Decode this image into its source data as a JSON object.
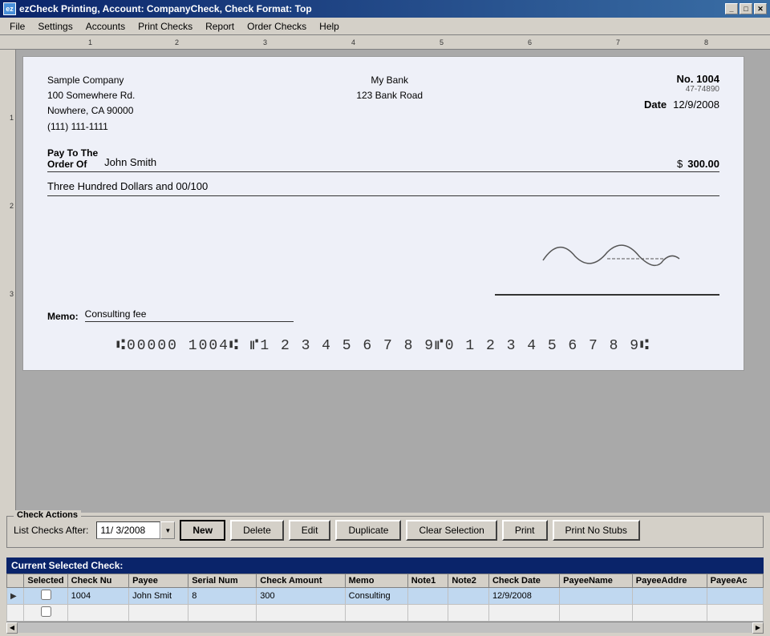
{
  "titleBar": {
    "title": "ezCheck Printing, Account: CompanyCheck, Check Format: Top",
    "icon": "ez"
  },
  "menuBar": {
    "items": [
      "File",
      "Settings",
      "Accounts",
      "Print Checks",
      "Report",
      "Order Checks",
      "Help"
    ]
  },
  "ruler": {
    "marks": [
      "1",
      "2",
      "3",
      "4",
      "5",
      "6",
      "7",
      "8"
    ]
  },
  "check": {
    "companyName": "Sample Company",
    "companyAddress1": "100 Somewhere Rd.",
    "companyAddress2": "Nowhere, CA 90000",
    "companyPhone": "(111) 111-1111",
    "bankName": "My Bank",
    "bankAddress": "123 Bank Road",
    "checkNoLabel": "No.",
    "checkNo": "1004",
    "routingDisplay": "47-74890",
    "dateLabel": "Date",
    "date": "12/9/2008",
    "payToLabel": "Pay To The\nOrder Of",
    "payee": "John Smith",
    "dollarSign": "$",
    "amount": "300.00",
    "amountWords": "Three Hundred  Dollars and 00/100",
    "memoLabel": "Memo:",
    "memo": "Consulting fee",
    "micrLine": "⑆00000 1004⑆ ⑈1 2 3 4 5 6 7 8 9⑈0 1 2 3 4 5 6 7 8 9⑆",
    "signatureText": "C∂Pmq̃—"
  },
  "actions": {
    "groupLabel": "Check Actions",
    "listAfterLabel": "List Checks After:",
    "dateValue": "11/ 3/2008",
    "buttons": {
      "new": "New",
      "delete": "Delete",
      "edit": "Edit",
      "duplicate": "Duplicate",
      "clearSelection": "Clear Selection",
      "print": "Print",
      "printNoStubs": "Print No Stubs"
    }
  },
  "currentSelected": {
    "title": "Current Selected Check:",
    "columns": [
      "Selected",
      "Check Nu",
      "Payee",
      "Serial Num",
      "Check Amount",
      "Memo",
      "Note1",
      "Note2",
      "Check Date",
      "PayeeName",
      "PayeeAddre",
      "PayeeAc"
    ],
    "rows": [
      {
        "arrow": "▶",
        "selected": false,
        "checkNum": "1004",
        "payee": "John Smit",
        "serialNum": "8",
        "amount": "300",
        "memo": "Consulting",
        "note1": "",
        "note2": "",
        "checkDate": "12/9/2008",
        "payeeName": "",
        "payeeAddr": "",
        "payeeAc": ""
      },
      {
        "arrow": "",
        "selected": false,
        "checkNum": "",
        "payee": "",
        "serialNum": "",
        "amount": "",
        "memo": "",
        "note1": "",
        "note2": "",
        "checkDate": "",
        "payeeName": "",
        "payeeAddr": "",
        "payeeAc": ""
      }
    ]
  }
}
